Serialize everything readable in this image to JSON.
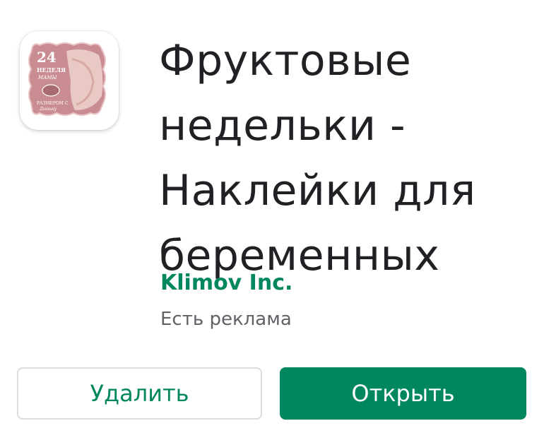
{
  "app": {
    "title_lines": [
      "Фруктовые",
      "недельки -",
      "Наклейки для",
      "беременных"
    ],
    "developer": "Klimov Inc.",
    "ads_notice": "Есть реклама",
    "icon": {
      "name": "app-icon",
      "week_number": "24",
      "week_word": "НЕДЕЛЯ",
      "subtitle": "МАМЫ",
      "size_text": "РАЗМЕРОМ С",
      "fruit_name": "Дыньку"
    }
  },
  "actions": {
    "uninstall_label": "Удалить",
    "open_label": "Открыть"
  },
  "colors": {
    "accent": "#01875f",
    "title": "#202124",
    "secondary_text": "#5f6368",
    "button_border": "#dadce0",
    "icon_background": "#c98c91"
  }
}
